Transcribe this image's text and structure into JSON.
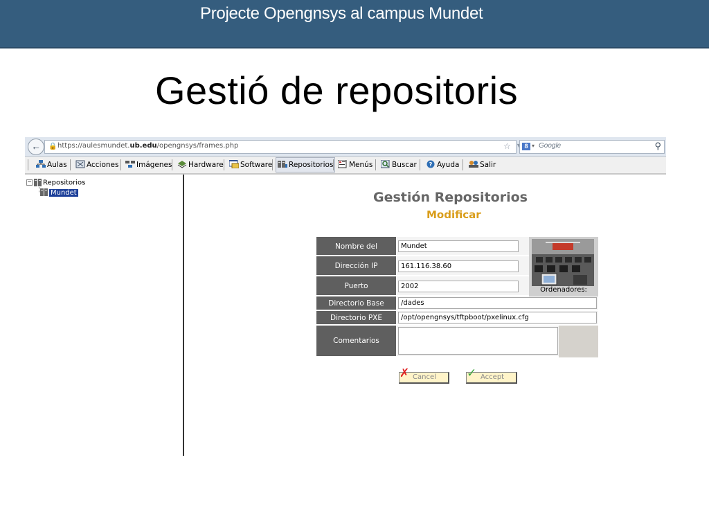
{
  "slide": {
    "banner_title": "Projecte Opengnsys al campus Mundet",
    "title": "Gestió de repositoris"
  },
  "browser": {
    "url_prefix": "https://aulesmundet.",
    "url_domain": "ub.edu",
    "url_suffix": "/opengnsys/frames.php",
    "search_placeholder": "Google"
  },
  "menu": {
    "items": [
      {
        "label": "Aulas",
        "icon": "classroom-icon"
      },
      {
        "label": "Acciones",
        "icon": "actions-icon"
      },
      {
        "label": "Imágenes",
        "icon": "images-icon"
      },
      {
        "label": "Hardware",
        "icon": "hardware-icon"
      },
      {
        "label": "Software",
        "icon": "software-icon"
      },
      {
        "label": "Repositorios",
        "icon": "repository-icon",
        "active": true
      },
      {
        "label": "Menús",
        "icon": "menu-icon"
      },
      {
        "label": "Buscar",
        "icon": "search-icon"
      },
      {
        "label": "Ayuda",
        "icon": "help-icon"
      },
      {
        "label": "Salir",
        "icon": "exit-icon"
      }
    ]
  },
  "tree": {
    "root_label": "Repositorios",
    "child_label": "Mundet"
  },
  "content": {
    "title": "Gestión Repositorios",
    "subtitle": "Modificar"
  },
  "form": {
    "name_label": "Nombre del Repositorio",
    "name_value": "Mundet",
    "ip_label": "Dirección IP",
    "ip_value": "161.116.38.60",
    "port_label": "Puerto",
    "port_value": "2002",
    "base_label": "Directorio Base",
    "base_value": "/dades",
    "pxe_label": "Directorio PXE",
    "pxe_value": "/opt/opengnsys/tftpboot/pxelinux.cfg",
    "comments_label": "Comentarios",
    "comments_value": "",
    "computers_label": "Ordenadores:"
  },
  "buttons": {
    "cancel": "Cancel",
    "accept": "Accept"
  },
  "colors": {
    "banner": "#355d7e",
    "label_bg": "#5f5f5f",
    "title_gray": "#666666",
    "subtitle_gold": "#d99d1a",
    "cancel_red": "#e02020",
    "accept_green": "#3aa53a"
  }
}
